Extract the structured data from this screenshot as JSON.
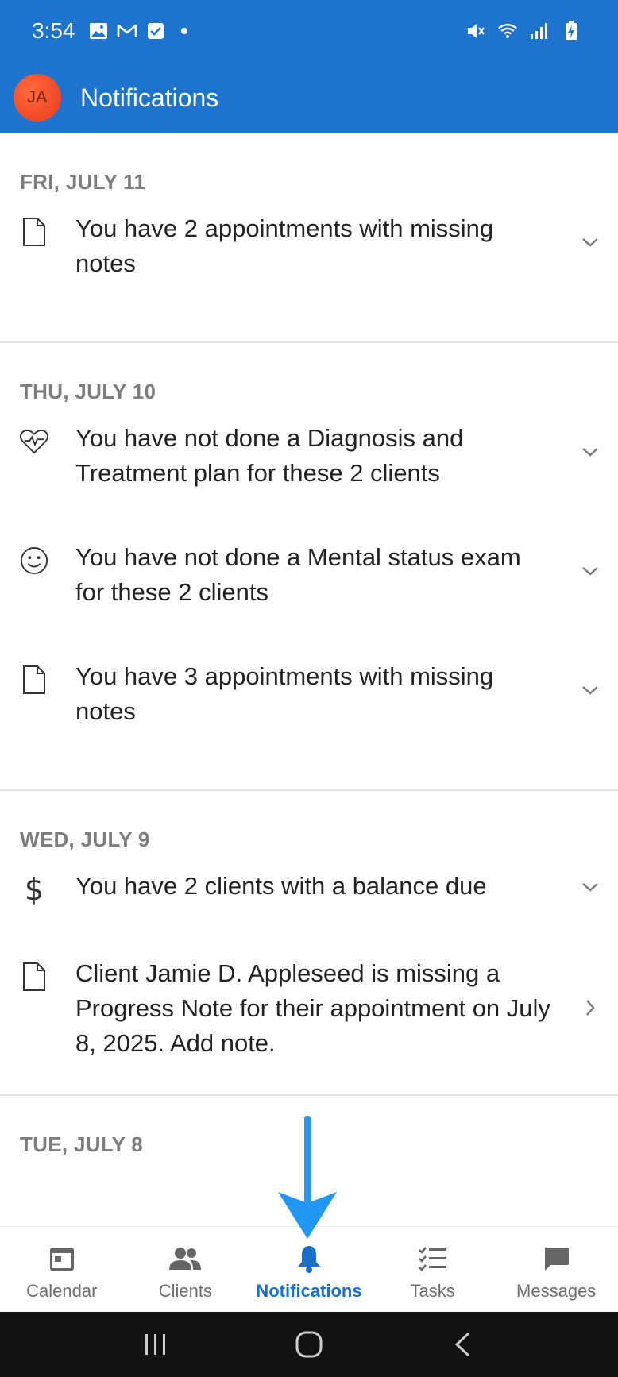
{
  "status_bar": {
    "time": "3:54",
    "left_icons": [
      "image-icon",
      "gmail-icon",
      "checkbox-icon",
      "dot-icon"
    ],
    "right_icons": [
      "mute-icon",
      "wifi-icon",
      "signal-icon",
      "battery-charging-icon"
    ]
  },
  "app_bar": {
    "avatar_initials": "JA",
    "title": "Notifications",
    "color": "#1e73cc"
  },
  "sections": [
    {
      "date": "FRI, JULY 11",
      "items": [
        {
          "icon": "document-icon",
          "text": "You have 2 appointments with missing notes",
          "action": "expand"
        }
      ]
    },
    {
      "date": "THU, JULY 10",
      "items": [
        {
          "icon": "heart-pulse-icon",
          "text": "You have not done a Diagnosis and Treatment plan for these 2 clients",
          "action": "expand"
        },
        {
          "icon": "smiley-icon",
          "text": "You have not done a Mental status exam for these 2 clients",
          "action": "expand"
        },
        {
          "icon": "document-icon",
          "text": "You have 3 appointments with missing notes",
          "action": "expand"
        }
      ]
    },
    {
      "date": "WED, JULY 9",
      "items": [
        {
          "icon": "dollar-icon",
          "text": "You have 2 clients with a balance due",
          "action": "expand"
        },
        {
          "icon": "document-icon",
          "text": "Client Jamie D. Appleseed is missing a Progress Note for their appointment on July 8, 2025. Add note.",
          "action": "navigate"
        }
      ]
    },
    {
      "date": "TUE, JULY 8",
      "items": []
    }
  ],
  "bottom_nav": {
    "items": [
      {
        "label": "Calendar",
        "icon": "calendar-icon"
      },
      {
        "label": "Clients",
        "icon": "people-icon"
      },
      {
        "label": "Notifications",
        "icon": "bell-icon"
      },
      {
        "label": "Tasks",
        "icon": "checklist-icon"
      },
      {
        "label": "Messages",
        "icon": "chat-icon"
      }
    ],
    "active": "Notifications",
    "active_color": "#1a6fc9"
  },
  "annotation": {
    "arrow_color": "#2196f3"
  }
}
